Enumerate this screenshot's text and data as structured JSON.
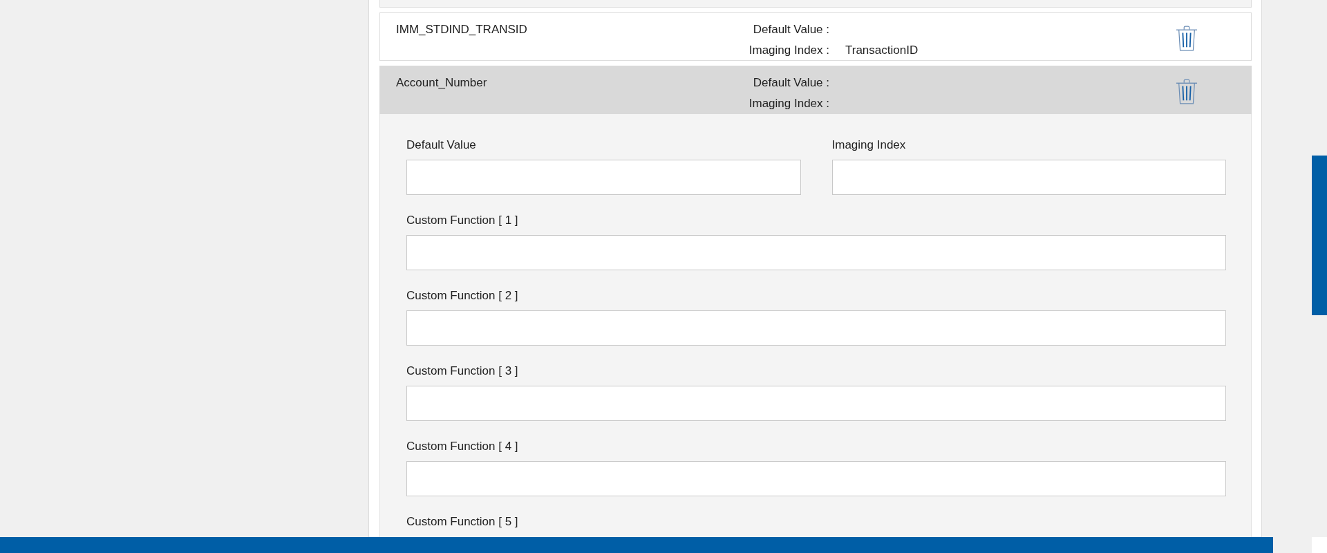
{
  "rows": [
    {
      "name": "IMM_STDIND_TRANSID",
      "default_label": "Default Value :",
      "index_label": "Imaging Index :",
      "index_value": "TransactionID",
      "expanded": false
    },
    {
      "name": "Account_Number",
      "default_label": "Default Value :",
      "index_label": "Imaging Index :",
      "expanded": true
    }
  ],
  "editor": {
    "fields": [
      {
        "label": "Default Value"
      },
      {
        "label": "Imaging Index"
      }
    ],
    "custom_functions": [
      {
        "label": "Custom Function [ 1 ]"
      },
      {
        "label": "Custom Function [ 2 ]"
      },
      {
        "label": "Custom Function [ 3 ]"
      },
      {
        "label": "Custom Function [ 4 ]"
      },
      {
        "label": "Custom Function [ 5 ]",
        "kind": "label"
      }
    ]
  }
}
